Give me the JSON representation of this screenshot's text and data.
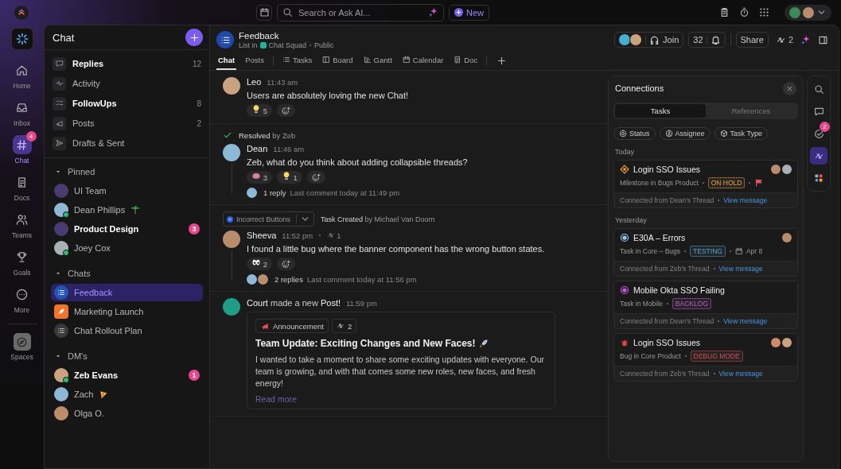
{
  "topbar": {
    "search_placeholder": "Search or Ask AI...",
    "new_label": "New"
  },
  "rail": [
    {
      "label": "Home",
      "kind": "home",
      "selected": false
    },
    {
      "label": "Inbox",
      "kind": "inbox",
      "selected": false
    },
    {
      "label": "Chat",
      "kind": "hash",
      "selected": true,
      "badge": "4"
    },
    {
      "label": "Docs",
      "kind": "doc",
      "selected": false
    },
    {
      "label": "Teams",
      "kind": "people",
      "selected": false
    },
    {
      "label": "Goals",
      "kind": "trophy",
      "selected": false
    },
    {
      "label": "More",
      "kind": "dots",
      "selected": false
    }
  ],
  "spaces": {
    "label": "Spaces"
  },
  "sidebar": {
    "title": "Chat",
    "nav": [
      {
        "label": "Replies",
        "kind": "chat",
        "count": "12",
        "unread": true
      },
      {
        "label": "Activity",
        "kind": "pulse",
        "unread": false
      },
      {
        "label": "FollowUps",
        "kind": "checklist",
        "count": "8",
        "unread": true
      },
      {
        "label": "Posts",
        "kind": "megaphone",
        "count": "2",
        "unread": false
      },
      {
        "label": "Drafts & Sent",
        "kind": "send",
        "unread": false
      }
    ],
    "sections": [
      {
        "title": "Pinned",
        "expanded": true,
        "items": [
          {
            "name": "UI Team",
            "kind": "group",
            "unread": false,
            "selected": false
          },
          {
            "name": "Dean Phillips",
            "kind": "person",
            "decoration": {
              "kind": "palm"
            },
            "online": true,
            "unread": false,
            "selected": false
          },
          {
            "name": "Product Design",
            "kind": "group",
            "unread": true,
            "badge": "3",
            "selected": false
          },
          {
            "name": "Joey Cox",
            "kind": "person",
            "online": true,
            "unread": false,
            "selected": false
          }
        ]
      },
      {
        "title": "Chats",
        "expanded": true,
        "items": [
          {
            "name": "Feedback",
            "kind": "list",
            "unread": false,
            "selected": true
          },
          {
            "name": "Marketing Launch",
            "kind": "rocket",
            "unread": false,
            "selected": false
          },
          {
            "name": "Chat Rollout Plan",
            "kind": "list-muted",
            "unread": false,
            "selected": false
          }
        ]
      },
      {
        "title": "DM's",
        "expanded": true,
        "items": [
          {
            "name": "Zeb Evans",
            "kind": "person",
            "online": true,
            "unread": true,
            "badge": "1",
            "selected": false
          },
          {
            "name": "Zach",
            "kind": "person",
            "decoration": {
              "kind": "pizza"
            },
            "unread": false,
            "selected": false
          },
          {
            "name": "Olga O.",
            "kind": "person",
            "unread": false,
            "selected": false
          }
        ]
      }
    ]
  },
  "channel": {
    "title": "Feedback",
    "location_prefix": "List in",
    "space": "Chat Squad",
    "visibility": "Public",
    "tabs": [
      {
        "label": "Chat",
        "kind": "text",
        "selected": true
      },
      {
        "label": "Posts",
        "kind": "text",
        "selected": false
      },
      {
        "label": "Tasks",
        "kind": "list",
        "selected": false
      },
      {
        "label": "Board",
        "kind": "board",
        "selected": false
      },
      {
        "label": "Gantt",
        "kind": "gantt",
        "selected": false
      },
      {
        "label": "Calendar",
        "kind": "calendar",
        "selected": false
      },
      {
        "label": "Doc",
        "kind": "doc",
        "selected": false
      }
    ],
    "join": "Join",
    "watchers": "32",
    "share": "Share",
    "connections": "2"
  },
  "messages": [
    {
      "kind": "message",
      "author": "Leo",
      "time": "11:43 am",
      "text": "Users are absolutely loving the new Chat!",
      "reactions": [
        {
          "kind": "bulb",
          "count": "5"
        }
      ]
    },
    {
      "kind": "message",
      "resolved": "**Resolved** by Zeb",
      "author": "Dean",
      "time": "11:46 am",
      "text": "Zeb, what do you think about adding collapsible threads?",
      "reactions": [
        {
          "kind": "brain",
          "count": "3"
        },
        {
          "kind": "bulb",
          "count": "1"
        }
      ],
      "thread": {
        "avatars": [
          {
            "kind": "photo"
          }
        ],
        "replies": "1 reply",
        "last": "Last comment today at 11:49 pm"
      }
    },
    {
      "kind": "message",
      "task_chip": "Incorrect Buttons",
      "task_note": "**Task Created** by Michael Van Doorn",
      "author": "Sheeva",
      "time": "11:52 pm",
      "connections": "1",
      "text": "I found a little bug where the banner component has the wrong button states.",
      "reactions": [
        {
          "kind": "eyes",
          "count": "2"
        }
      ],
      "thread": {
        "avatars": [
          {
            "kind": "photo"
          },
          {
            "kind": "photo"
          }
        ],
        "replies": "2 replies",
        "last": "Last comment today at 11:56 pm"
      }
    },
    {
      "kind": "post",
      "headline": "**Court** made a new **Post!**",
      "time": "11:59 pm",
      "post": {
        "tag": "Announcement",
        "connections": "2",
        "title": "Team Update: Exciting Changes and New Faces!",
        "text": "I wanted to take a moment to share some exciting updates with everyone. Our team is growing, and with that comes some new roles, new faces, and fresh energy!",
        "link": "Read more"
      }
    }
  ],
  "connections": {
    "title": "Connections",
    "tabs": [
      {
        "label": "Tasks",
        "selected": true
      },
      {
        "label": "References",
        "selected": false
      }
    ],
    "filters": [
      {
        "label": "Status",
        "kind": "target"
      },
      {
        "label": "Assignee",
        "kind": "usercircle"
      },
      {
        "label": "Task Type",
        "kind": "cube"
      }
    ],
    "groups": [
      {
        "label": "Today",
        "tasks": [
          {
            "kind": "milestone",
            "title": "Login SSO Issues",
            "context": "Milestone in Bugs Product",
            "status": "ON HOLD",
            "color": "#f0a030",
            "flagged": true,
            "assignees": [
              {
                "kind": "photo"
              },
              {
                "kind": "photo"
              }
            ],
            "source": "Connected from Dean's Thread",
            "link": "View message"
          }
        ]
      },
      {
        "label": "Yesterday",
        "tasks": [
          {
            "kind": "task",
            "title": "E30A – Errors",
            "context": "Task in Core – Bugs",
            "status": "TESTING",
            "color": "#4aa3e0",
            "date": "Apr 8",
            "assignees": [
              {
                "kind": "photo"
              }
            ],
            "source": "Connected from Zeb's Thread",
            "link": "View message"
          },
          {
            "kind": "task-purple",
            "title": "Mobile Okta SSO Failing",
            "context": "Task in Mobile",
            "status": "BACKLOG",
            "color": "#d04ee0",
            "source": "Connected from Dean's Thread",
            "link": "View message"
          },
          {
            "kind": "bug",
            "title": "Login SSO Issues",
            "context": "Bug in Core Product",
            "status": "DEBUG MODE",
            "color": "#e0474c",
            "assignees": [
              {
                "kind": "photo"
              },
              {
                "kind": "photo"
              }
            ],
            "source": "Connected from Zeb's Thread",
            "link": "View message"
          }
        ]
      }
    ]
  },
  "right_rail": [
    {
      "kind": "search",
      "selected": false
    },
    {
      "kind": "chat",
      "selected": false
    },
    {
      "kind": "check",
      "selected": false,
      "badge": "2"
    },
    {
      "kind": "connect",
      "selected": true
    },
    {
      "kind": "apps",
      "selected": false
    }
  ]
}
